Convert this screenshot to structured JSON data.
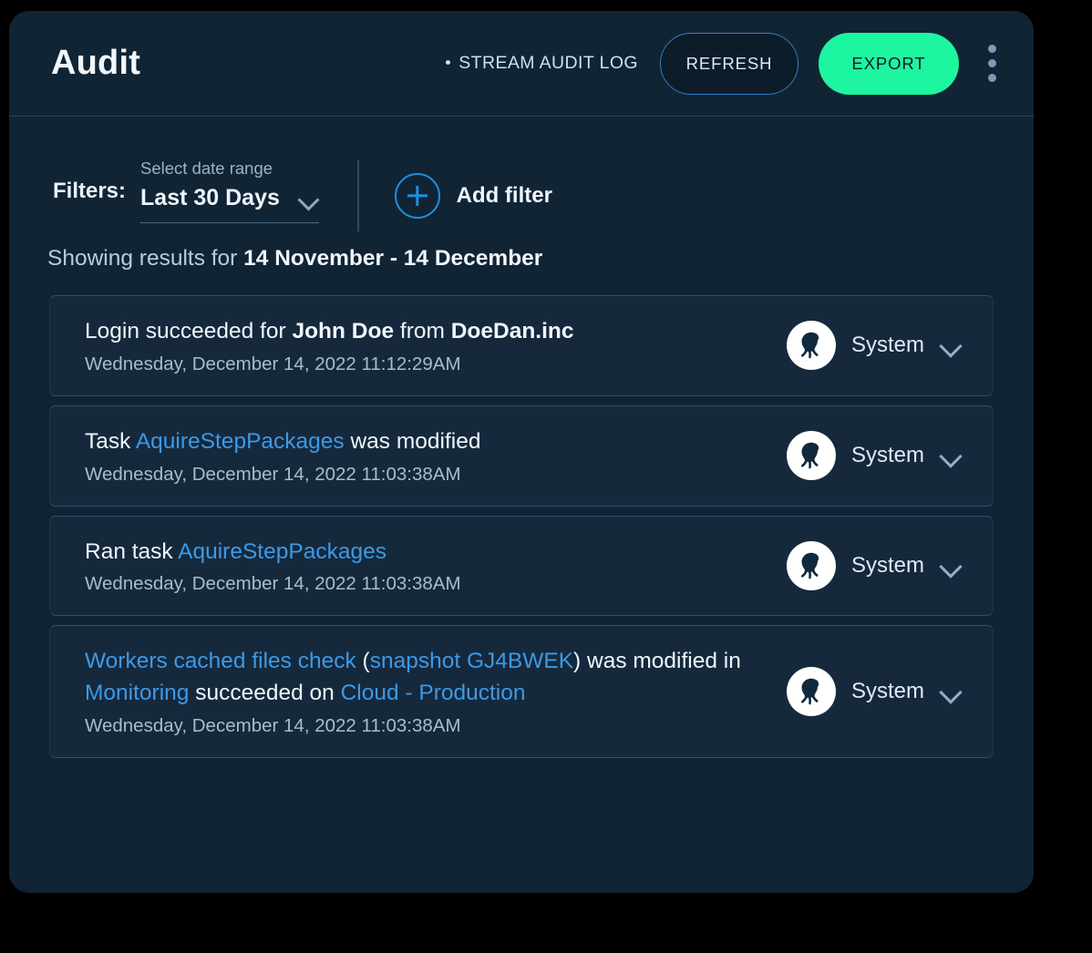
{
  "header": {
    "title": "Audit",
    "stream_label": "STREAM AUDIT LOG",
    "refresh_label": "REFRESH",
    "export_label": "EXPORT",
    "accent_green": "#1df5a0",
    "accent_blue": "#2a7fc9"
  },
  "filters": {
    "label": "Filters:",
    "date_range_label": "Select date range",
    "date_range_value": "Last 30 Days",
    "add_filter_label": "Add filter"
  },
  "results": {
    "prefix": "Showing results for ",
    "range": "14 November - 14 December"
  },
  "rows": [
    {
      "segments": [
        {
          "text": "Login succeeded for ",
          "style": "plain"
        },
        {
          "text": "John Doe",
          "style": "bold"
        },
        {
          "text": " from ",
          "style": "plain"
        },
        {
          "text": "DoeDan.inc",
          "style": "bold"
        }
      ],
      "timestamp": "Wednesday, December 14, 2022 11:12:29AM",
      "user": "System"
    },
    {
      "segments": [
        {
          "text": "Task ",
          "style": "plain"
        },
        {
          "text": "AquireStepPackages",
          "style": "link"
        },
        {
          "text": " was modified",
          "style": "plain"
        }
      ],
      "timestamp": "Wednesday, December 14, 2022 11:03:38AM",
      "user": "System"
    },
    {
      "segments": [
        {
          "text": "Ran task ",
          "style": "plain"
        },
        {
          "text": "AquireStepPackages",
          "style": "link"
        }
      ],
      "timestamp": "Wednesday, December 14, 2022 11:03:38AM",
      "user": "System"
    },
    {
      "segments": [
        {
          "text": "Workers cached files check",
          "style": "link"
        },
        {
          "text": " (",
          "style": "plain"
        },
        {
          "text": "snapshot GJ4BWEK",
          "style": "link"
        },
        {
          "text": ") was modified in ",
          "style": "plain"
        },
        {
          "text": "Monitoring",
          "style": "link"
        },
        {
          "text": " succeeded on ",
          "style": "plain"
        },
        {
          "text": "Cloud - Production",
          "style": "link"
        }
      ],
      "timestamp": "Wednesday, December 14, 2022 11:03:38AM",
      "user": "System"
    }
  ],
  "icons": {
    "avatar": "octopus-icon",
    "kebab": "more-vertical-icon",
    "add": "plus-circle-icon",
    "chevron": "chevron-down-icon"
  }
}
